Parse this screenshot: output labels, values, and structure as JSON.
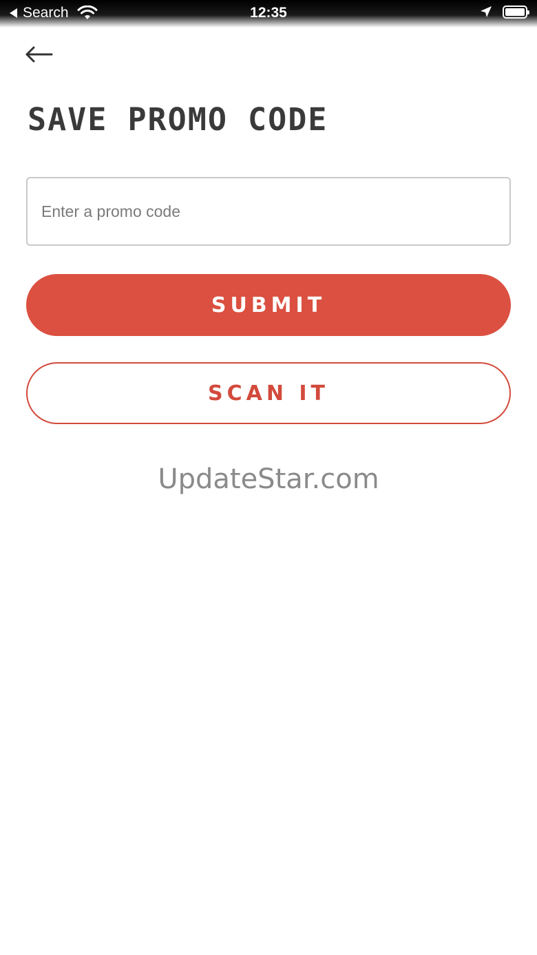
{
  "status_bar": {
    "back_app_label": "Search",
    "time": "12:35",
    "icons": [
      "back-triangle-icon",
      "wifi-icon",
      "location-arrow-icon",
      "battery-icon"
    ]
  },
  "nav": {
    "back_icon": "arrow-left-icon"
  },
  "page": {
    "title": "SAVE PROMO CODE"
  },
  "promo_input": {
    "placeholder": "Enter a promo code",
    "value": ""
  },
  "buttons": {
    "submit_label": "SUBMIT",
    "scan_label": "SCAN IT"
  },
  "watermark": {
    "text": "UpdateStar.com"
  },
  "colors": {
    "accent": "#db5040",
    "title": "#3a3a3a",
    "input_border": "#c9c9c9",
    "watermark": "#8a8a8a"
  }
}
